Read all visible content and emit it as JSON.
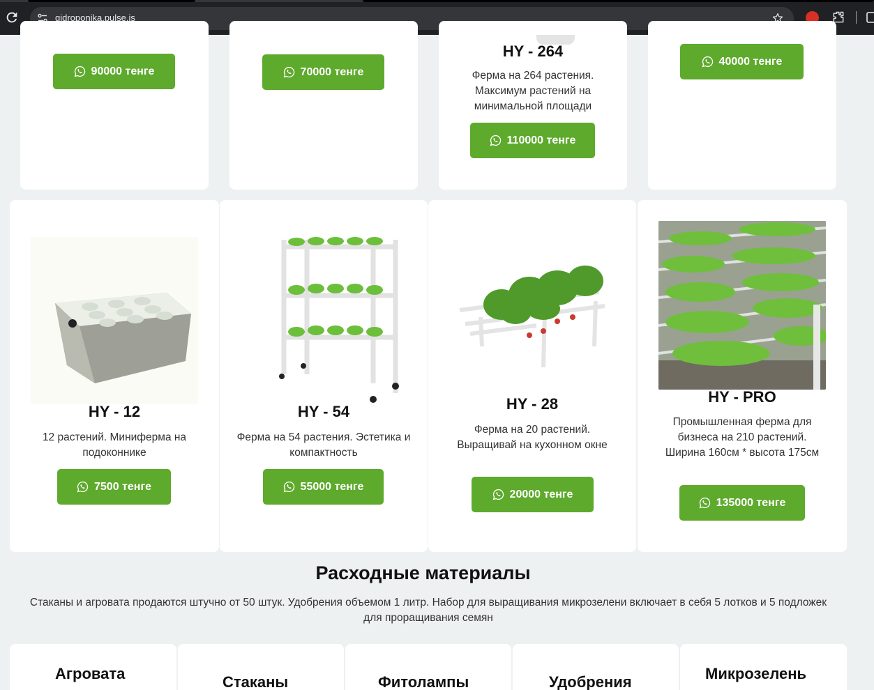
{
  "browser": {
    "url": "gidroponika.pulse.is",
    "icons": [
      "reload-icon",
      "site-info-icon",
      "bookmark-star-icon",
      "extension-red-icon",
      "extensions-puzzle-icon"
    ]
  },
  "colors": {
    "accent": "#5daa2c",
    "background": "#eef1f1",
    "card": "#ffffff"
  },
  "top_row": [
    {
      "price": "90000 тенге"
    },
    {
      "price": "70000 тенге"
    },
    {
      "title": "HY - 264",
      "desc": "Ферма на 264 растения. Максимум растений на минимальной площади",
      "price": "110000 тенге"
    },
    {
      "price": "40000 тенге"
    }
  ],
  "products": [
    {
      "title": "HY - 12",
      "desc": "12 растений. Миниферма на подоконнике",
      "price": "7500 тенге",
      "image": "white-hydroponic-box"
    },
    {
      "title": "HY - 54",
      "desc": "Ферма на 54 растения. Эстетика и компактность",
      "price": "55000 тенге",
      "image": "three-tier-rack"
    },
    {
      "title": "HY - 28",
      "desc": "Ферма на 20 растений. Выращивай на кухонном окне",
      "price": "20000 тенге",
      "image": "pipe-farm-with-strawberries"
    },
    {
      "title": "HY - PRO",
      "desc": "Промышленная ферма для бизнеса на 210 растений. Ширина 160см * высота 175см",
      "price": "135000 тенге",
      "image": "greenhouse-industrial-farm"
    }
  ],
  "consumables": {
    "title": "Расходные материалы",
    "desc": "Стаканы и агровата продаются штучно от 50 штук. Удобрения объемом 1 литр. Набор для выращивания микрозелени включает в себя 5 лотков и 5 подложек для проращивания семян",
    "categories": [
      "Агровата",
      "Стаканы",
      "Фитолампы",
      "Удобрения",
      "Микрозелень"
    ]
  }
}
